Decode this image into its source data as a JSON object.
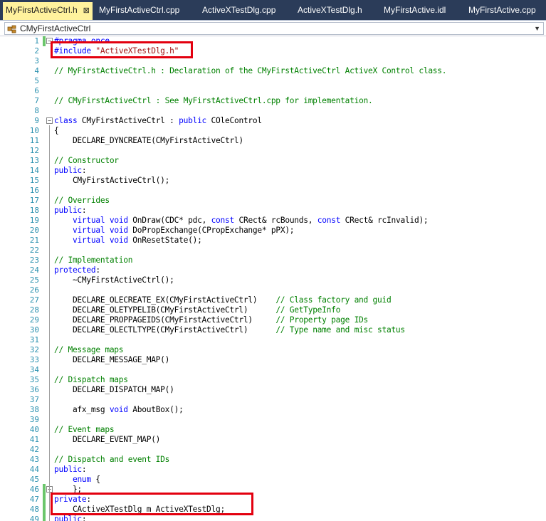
{
  "tabs": [
    {
      "label": "MyFirstActiveCtrl.h",
      "active": true,
      "close": "⊠"
    },
    {
      "label": "MyFirstActiveCtrl.cpp",
      "active": false
    },
    {
      "label": "ActiveXTestDlg.cpp",
      "active": false
    },
    {
      "label": "ActiveXTestDlg.h",
      "active": false
    },
    {
      "label": "MyFirstActive.idl",
      "active": false
    },
    {
      "label": "MyFirstActive.cpp",
      "active": false
    }
  ],
  "nav": {
    "scope": "CMyFirstActiveCtrl",
    "icon": "class-icon"
  },
  "colors": {
    "tabbar": "#2b3c59",
    "active_tab": "#fff29d",
    "keyword": "#0000ff",
    "comment": "#008000",
    "highlight_box": "#e3000f"
  },
  "code": {
    "line_numbers": [
      "1",
      "2",
      "3",
      "4",
      "5",
      "6",
      "7",
      "8",
      "9",
      "10",
      "11",
      "12",
      "13",
      "14",
      "15",
      "16",
      "17",
      "18",
      "19",
      "20",
      "21",
      "22",
      "23",
      "24",
      "25",
      "26",
      "27",
      "28",
      "29",
      "30",
      "31",
      "32",
      "33",
      "34",
      "35",
      "36",
      "37",
      "38",
      "39",
      "40",
      "41",
      "42",
      "43",
      "44",
      "45",
      "46",
      "47",
      "48",
      "49"
    ],
    "lines": [
      "#pragma once",
      "#include \"ActiveXTestDlg.h\"",
      "",
      "// MyFirstActiveCtrl.h : Declaration of the CMyFirstActiveCtrl ActiveX Control class.",
      "",
      "",
      "// CMyFirstActiveCtrl : See MyFirstActiveCtrl.cpp for implementation.",
      "",
      "class CMyFirstActiveCtrl : public COleControl",
      "{",
      "    DECLARE_DYNCREATE(CMyFirstActiveCtrl)",
      "",
      "// Constructor",
      "public:",
      "    CMyFirstActiveCtrl();",
      "",
      "// Overrides",
      "public:",
      "    virtual void OnDraw(CDC* pdc, const CRect& rcBounds, const CRect& rcInvalid);",
      "    virtual void DoPropExchange(CPropExchange* pPX);",
      "    virtual void OnResetState();",
      "",
      "// Implementation",
      "protected:",
      "    ~CMyFirstActiveCtrl();",
      "",
      "    DECLARE_OLECREATE_EX(CMyFirstActiveCtrl)    // Class factory and guid",
      "    DECLARE_OLETYPELIB(CMyFirstActiveCtrl)      // GetTypeInfo",
      "    DECLARE_PROPPAGEIDS(CMyFirstActiveCtrl)     // Property page IDs",
      "    DECLARE_OLECTLTYPE(CMyFirstActiveCtrl)      // Type name and misc status",
      "",
      "// Message maps",
      "    DECLARE_MESSAGE_MAP()",
      "",
      "// Dispatch maps",
      "    DECLARE_DISPATCH_MAP()",
      "",
      "    afx_msg void AboutBox();",
      "",
      "// Event maps",
      "    DECLARE_EVENT_MAP()",
      "",
      "// Dispatch and event IDs",
      "public:",
      "    enum {",
      "    };",
      "private:",
      "    CActiveXTestDlg m_ActiveXTestDlg;",
      "public:"
    ]
  }
}
